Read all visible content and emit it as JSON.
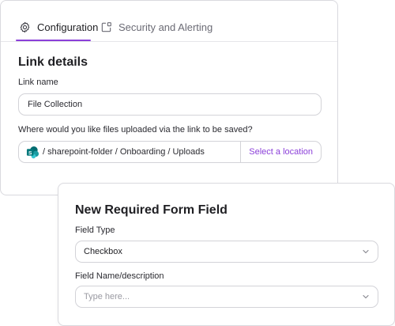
{
  "tabs": [
    {
      "label": "Configuration",
      "icon": "gear-icon",
      "active": true
    },
    {
      "label": "Security and Alerting",
      "icon": "external-link-icon",
      "active": false
    }
  ],
  "link_details": {
    "heading": "Link details",
    "link_name_label": "Link name",
    "link_name_value": "File Collection",
    "location_question": "Where would you like files uploaded via the link to be saved?",
    "location_path": "/ sharepoint-folder / Onboarding / Uploads",
    "select_location_label": "Select a location"
  },
  "form_field": {
    "heading": "New Required Form Field",
    "field_type_label": "Field Type",
    "field_type_value": "Checkbox",
    "field_name_label": "Field Name/description",
    "field_name_placeholder": "Type here..."
  },
  "colors": {
    "accent": "#8b3fd9",
    "sharepoint": "#038387"
  }
}
